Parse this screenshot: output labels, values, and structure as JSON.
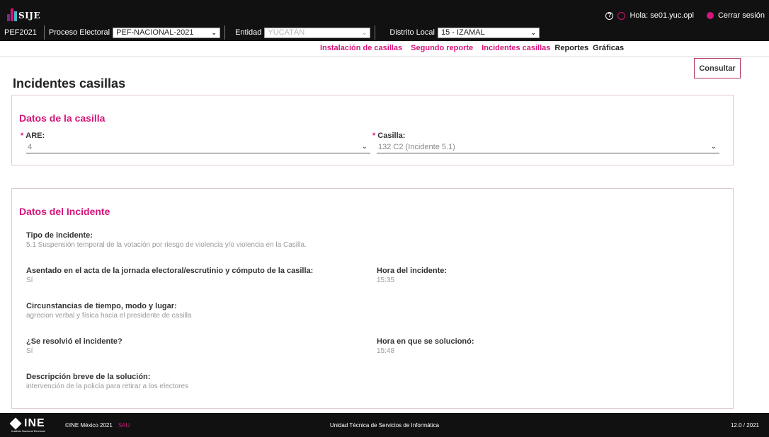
{
  "app": {
    "logo_text": "SIJE",
    "logo_colors": [
      "#7a2a8a",
      "#d5157a",
      "#3fb8c8"
    ]
  },
  "header": {
    "program": "PEF2021",
    "proceso_label": "Proceso Electoral",
    "proceso_value": "PEF-NACIONAL-2021",
    "entidad_label": "Entidad",
    "entidad_value": "YUCATÁN",
    "distrito_label": "Distrito Local",
    "distrito_value": "15 - IZAMAL",
    "greeting": "Hola: se01.yuc.opl",
    "logout": "Cerrar sesión"
  },
  "tabs": [
    {
      "label": "Instalación de casillas"
    },
    {
      "label": "Segundo reporte"
    },
    {
      "label": "Incidentes casillas"
    },
    {
      "label": "Reportes"
    },
    {
      "label": "Gráficas"
    }
  ],
  "actions": {
    "consultar": "Consultar"
  },
  "page": {
    "title": "Incidentes casillas"
  },
  "casilla_card": {
    "title": "Datos de la casilla",
    "are_label": "ARE:",
    "are_value": "4",
    "casilla_label": "Casilla:",
    "casilla_value": "132 C2 (Incidente 5.1)",
    "required_mark": "*"
  },
  "incidente_card": {
    "title": "Datos del Incidente",
    "fields": {
      "tipo": {
        "label": "Tipo de incidente:",
        "value": "5.1 Suspensión temporal de la votación por riesgo de violencia y/o violencia en la Casilla."
      },
      "asentado": {
        "label": "Asentado en el acta de la jornada electoral/escrutinio y cómputo de la casilla:",
        "value": "Sí"
      },
      "hora": {
        "label": "Hora del incidente:",
        "value": "15:35"
      },
      "circunstancias": {
        "label": "Circunstancias de tiempo, modo y lugar:",
        "value": "agrecion verbal y física hacia el presidente de casilla"
      },
      "resolvio": {
        "label": "¿Se resolvió el incidente?",
        "value": "Sí"
      },
      "hora_solucion": {
        "label": "Hora en que se solucionó:",
        "value": "15:48"
      },
      "descripcion": {
        "label": "Descripción breve de la solución:",
        "value": "intervención de la policía para retirar a los electores"
      }
    }
  },
  "footer": {
    "logo": "INE",
    "logo_sub": "Instituto Nacional Electoral",
    "copyright": "©INE México 2021",
    "sau": "SAU",
    "center": "Unidad Técnica de Servicios de Informática",
    "version": "12.0 / 2021"
  },
  "colors": {
    "accent": "#d5157a",
    "topbar": "#111111"
  }
}
